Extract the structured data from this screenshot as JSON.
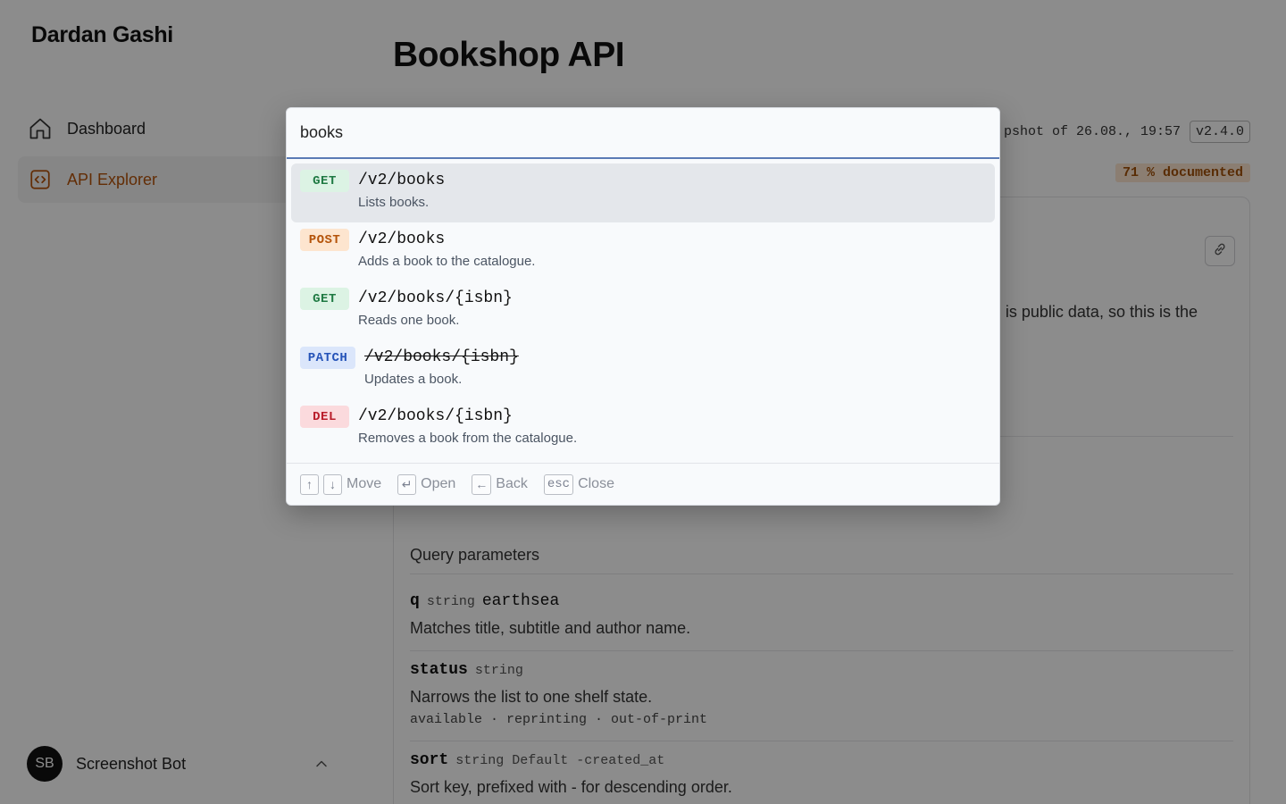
{
  "brand": "Dardan Gashi",
  "nav": {
    "items": [
      {
        "label": "Dashboard",
        "icon": "home-icon",
        "active": false
      },
      {
        "label": "API Explorer",
        "icon": "code-icon",
        "active": true
      }
    ]
  },
  "user": {
    "initials": "SB",
    "name": "Screenshot Bot"
  },
  "main": {
    "title": "Bookshop API",
    "snapshot_text": "pshot of 26.08., 19:57",
    "version": "v2.4.0",
    "documented": "71 % documented",
    "card_desc_fragment": "is public data, so this is the",
    "query_params_title": "Query parameters",
    "params": [
      {
        "name": "q",
        "type": "string",
        "value": "earthsea",
        "desc": "Matches title, subtitle and author name."
      },
      {
        "name": "status",
        "type": "string",
        "desc": "Narrows the list to one shelf state.",
        "enum": "available · reprinting · out-of-print"
      },
      {
        "name": "sort",
        "type": "string Default -created_at",
        "desc": "Sort key, prefixed with - for descending order."
      }
    ]
  },
  "palette": {
    "query": "books",
    "results": [
      {
        "method": "GET",
        "path": "/v2/books",
        "desc": "Lists books."
      },
      {
        "method": "POST",
        "path": "/v2/books",
        "desc": "Adds a book to the catalogue."
      },
      {
        "method": "GET",
        "path": "/v2/books/{isbn}",
        "desc": "Reads one book."
      },
      {
        "method": "PATCH",
        "path": "/v2/books/{isbn}",
        "desc": "Updates a book."
      },
      {
        "method": "DEL",
        "path": "/v2/books/{isbn}",
        "desc": "Removes a book from the catalogue."
      }
    ],
    "footer": {
      "up_key": "↑",
      "down_key": "↓",
      "move": "Move",
      "enter_key": "↵",
      "open": "Open",
      "back_key": "←",
      "back": "Back",
      "esc_key": "esc",
      "close": "Close"
    }
  }
}
